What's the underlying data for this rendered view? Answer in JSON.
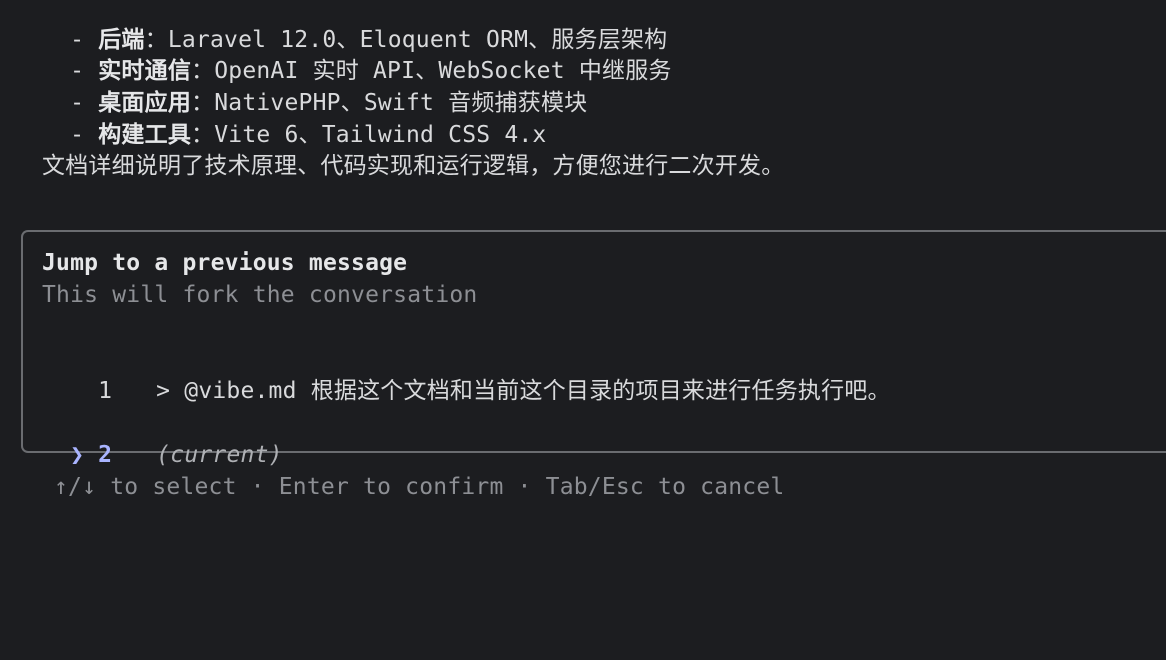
{
  "transcript": {
    "stack_lines": [
      {
        "prefix": "- ",
        "label": "后端",
        "sep": "：",
        "value": "Laravel 12.0、Eloquent ORM、服务层架构"
      },
      {
        "prefix": "- ",
        "label": "实时通信",
        "sep": "：",
        "value": "OpenAI 实时 API、WebSocket 中继服务"
      },
      {
        "prefix": "- ",
        "label": "桌面应用",
        "sep": "：",
        "value": "NativePHP、Swift 音频捕获模块"
      },
      {
        "prefix": "- ",
        "label": "构建工具",
        "sep": "：",
        "value": "Vite 6、Tailwind CSS 4.x"
      }
    ],
    "summary": "文档详细说明了技术原理、代码实现和运行逻辑，方便您进行二次开发。"
  },
  "jump_dialog": {
    "title": "Jump to a previous message",
    "subtitle": "This will fork the conversation",
    "items": [
      {
        "number": "1",
        "text": "> @vibe.md 根据这个文档和当前这个目录的项目来进行任务执行吧。",
        "selected": false
      },
      {
        "number": "2",
        "text": "(current)",
        "selected": true
      }
    ],
    "selection_marker": "❯"
  },
  "footer_hint": "↑/↓ to select · Enter to confirm · Tab/Esc to cancel"
}
